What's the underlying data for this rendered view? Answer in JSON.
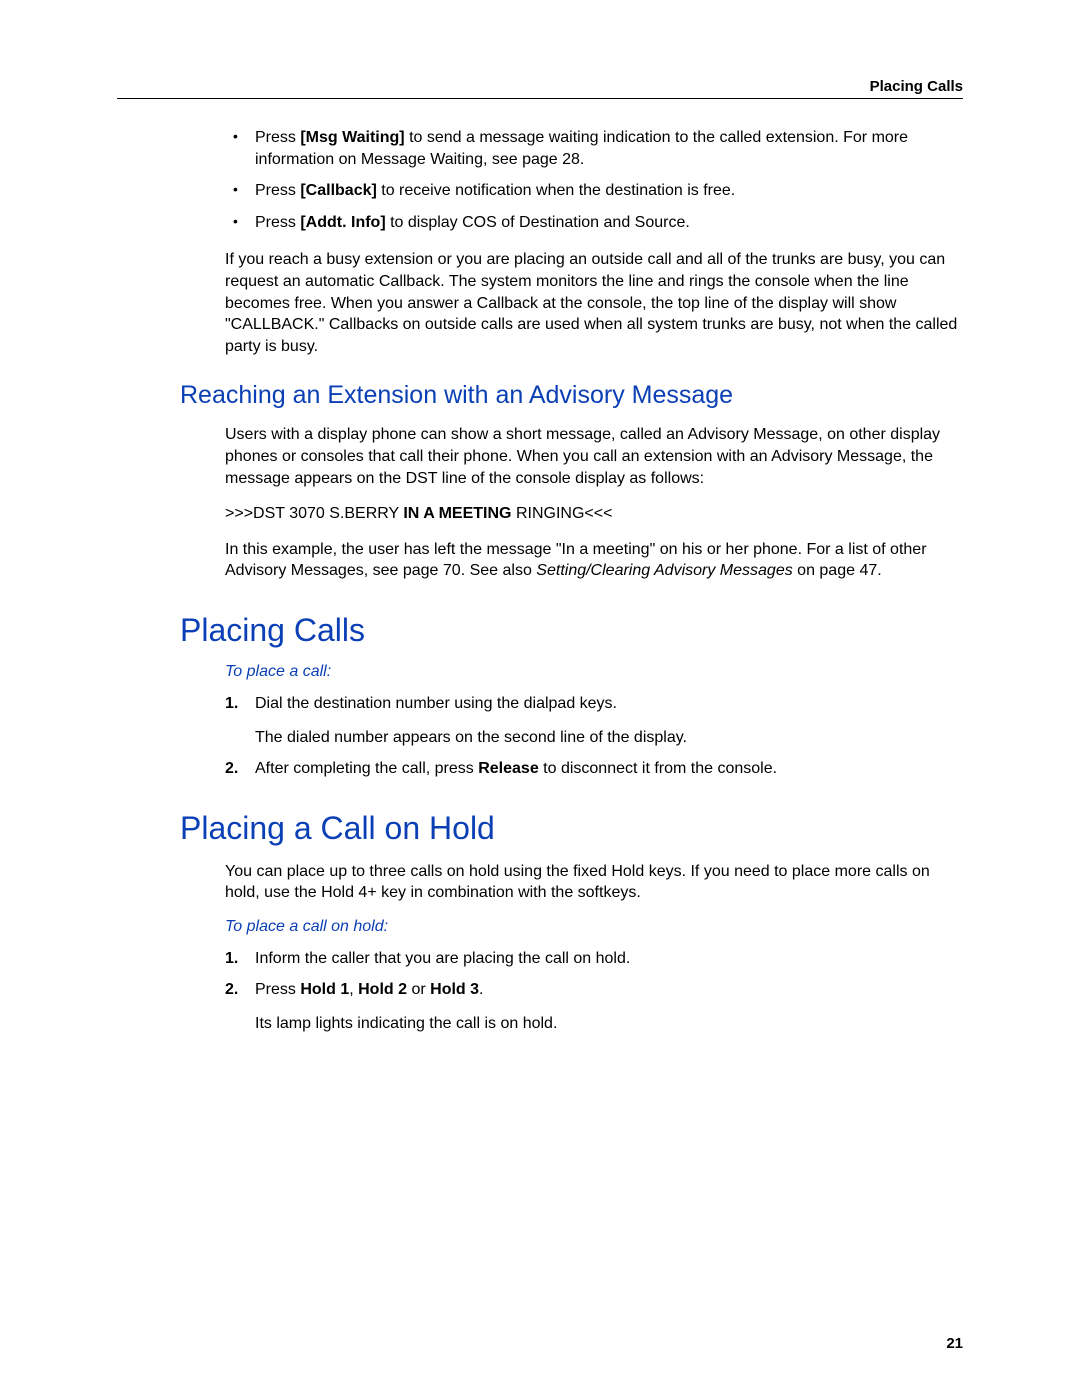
{
  "header": {
    "right": "Placing Calls"
  },
  "bullets": [
    {
      "pre": "Press ",
      "bold": "[Msg Waiting]",
      "post": " to send a message waiting indication to the called extension. For more information on Message Waiting, see page 28."
    },
    {
      "pre": "Press ",
      "bold": "[Callback]",
      "post": " to receive notification when the destination is free."
    },
    {
      "pre": "Press ",
      "bold": "[Addt. Info]",
      "post": " to display COS of Destination and Source."
    }
  ],
  "para_callback": "If you reach a busy extension or you are placing an outside call and all of the trunks are busy, you can request an automatic Callback. The system monitors the line and rings the console when the line becomes free. When you answer a Callback at the console, the top line of the display will show \"CALLBACK.\" Callbacks on outside calls are used when all system trunks are busy, not when the called party is busy.",
  "subhead_advisory": "Reaching an Extension with an Advisory Message",
  "para_advisory1": "Users with a display phone can show a short message, called an Advisory Message, on other display phones or consoles that call their phone. When you call an extension with an Advisory Message, the message appears on the DST line of the console display as follows:",
  "dst_line_pre": ">>>DST 3070 S.BERRY    ",
  "dst_line_bold": "IN A MEETING",
  "dst_line_post": " RINGING<<<",
  "para_advisory2_pre": "In this example, the user has left the message \"In a meeting\" on his or her phone. For a list of other Advisory Messages, see page 70. See also ",
  "para_advisory2_ital": "Setting/Clearing Advisory Messages",
  "para_advisory2_post": " on page 47.",
  "head_placing": "Placing Calls",
  "proc_place_title": "To place a call:",
  "steps_place": [
    {
      "text": "Dial the destination number using the dialpad keys.",
      "sub": "The dialed number appears on the second line of the display."
    },
    {
      "pre": "After completing the call, press ",
      "bold": "Release",
      "post": " to disconnect it from the console."
    }
  ],
  "head_hold": "Placing a Call on Hold",
  "para_hold": "You can place up to three calls on hold using the fixed Hold keys. If you need to place more calls on hold, use the Hold 4+ key in combination with the softkeys.",
  "proc_hold_title": "To place a call on hold:",
  "steps_hold": [
    {
      "text": "Inform the caller that you are placing the call on hold."
    },
    {
      "pre": "Press ",
      "bold": "Hold 1",
      "mid1": ", ",
      "bold2": "Hold 2",
      "mid2": " or ",
      "bold3": "Hold 3",
      "post": ".",
      "sub": "Its lamp lights indicating the call is on hold."
    }
  ],
  "page_number": "21"
}
